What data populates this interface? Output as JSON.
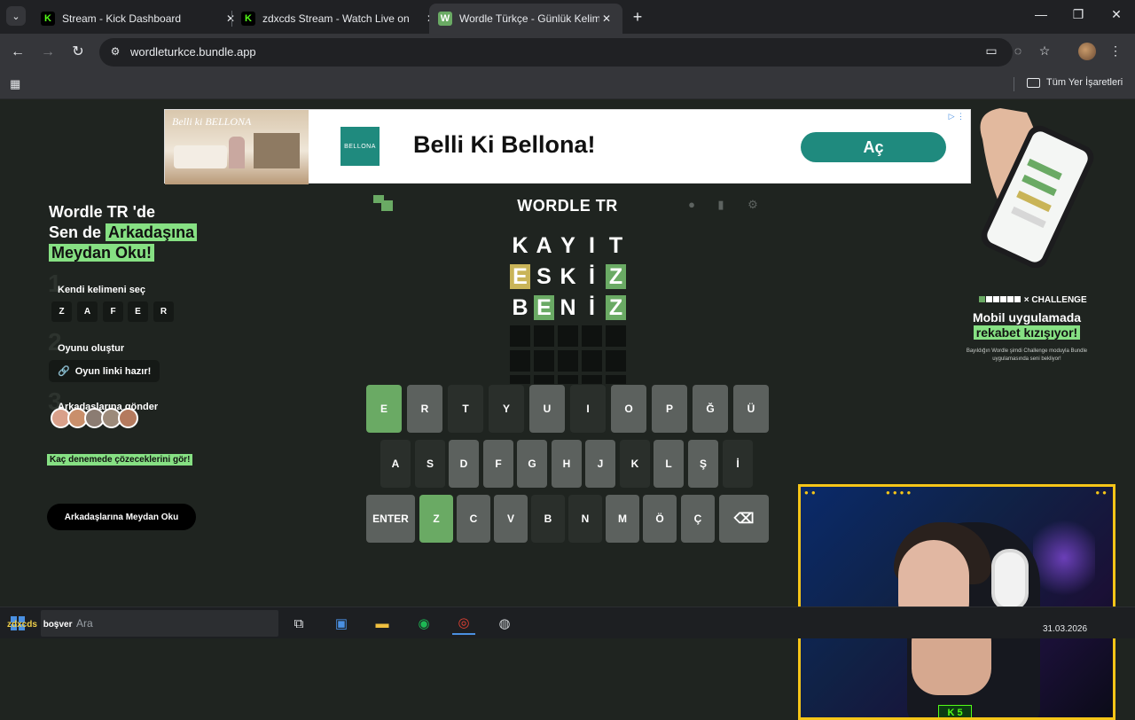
{
  "browser": {
    "tabs": [
      {
        "title": "Stream - Kick Dashboard",
        "favicon": "K",
        "active": false
      },
      {
        "title": "zdxcds Stream - Watch Live on",
        "favicon": "K",
        "active": false
      },
      {
        "title": "Wordle Türkçe - Günlük Kelime",
        "favicon": "W",
        "active": true
      }
    ],
    "url": "wordleturkce.bundle.app",
    "bookmarks_all": "Tüm Yer İşaretleri"
  },
  "ad": {
    "image_brand": "Belli ki BELLONA",
    "logo_text": "BELLONA",
    "headline": "Belli Ki Bellona!",
    "cta": "Aç"
  },
  "promo": {
    "title_line1": "Wordle TR 'de",
    "title_line2a": "Sen de ",
    "title_line2b": "Arkadaşına",
    "title_line3": "Meydan Oku!",
    "step1_num": "1",
    "step1_label": "Kendi kelimeni seç",
    "step1_letters": [
      "Z",
      "A",
      "F",
      "E",
      "R"
    ],
    "step2_num": "2",
    "step2_label": "Oyunu oluştur",
    "step2_chip": "Oyun linki hazır!",
    "step3_num": "3",
    "step3_label": "Arkadaşlarına gönder",
    "tag": "Kaç denemede çözeceklerini gör!",
    "button": "Arkadaşlarına Meydan Oku"
  },
  "game": {
    "title": "WORDLE TR",
    "rows": [
      [
        {
          "l": "K",
          "s": "plain"
        },
        {
          "l": "A",
          "s": "plain"
        },
        {
          "l": "Y",
          "s": "plain"
        },
        {
          "l": "I",
          "s": "plain"
        },
        {
          "l": "T",
          "s": "plain"
        }
      ],
      [
        {
          "l": "E",
          "s": "present"
        },
        {
          "l": "S",
          "s": "plain"
        },
        {
          "l": "K",
          "s": "plain"
        },
        {
          "l": "İ",
          "s": "plain"
        },
        {
          "l": "Z",
          "s": "correct"
        }
      ],
      [
        {
          "l": "B",
          "s": "plain"
        },
        {
          "l": "E",
          "s": "correct"
        },
        {
          "l": "N",
          "s": "plain"
        },
        {
          "l": "İ",
          "s": "plain"
        },
        {
          "l": "Z",
          "s": "correct"
        }
      ]
    ],
    "keyboard": [
      [
        {
          "k": "E",
          "s": "correct"
        },
        {
          "k": "R",
          "s": "used"
        },
        {
          "k": "T",
          "s": "plain"
        },
        {
          "k": "Y",
          "s": "plain"
        },
        {
          "k": "U",
          "s": "used"
        },
        {
          "k": "I",
          "s": "plain"
        },
        {
          "k": "O",
          "s": "used"
        },
        {
          "k": "P",
          "s": "used"
        },
        {
          "k": "Ğ",
          "s": "used"
        },
        {
          "k": "Ü",
          "s": "used"
        }
      ],
      [
        {
          "k": "A",
          "s": "plain"
        },
        {
          "k": "S",
          "s": "plain"
        },
        {
          "k": "D",
          "s": "used"
        },
        {
          "k": "F",
          "s": "used"
        },
        {
          "k": "G",
          "s": "used"
        },
        {
          "k": "H",
          "s": "used"
        },
        {
          "k": "J",
          "s": "used"
        },
        {
          "k": "K",
          "s": "plain"
        },
        {
          "k": "L",
          "s": "used"
        },
        {
          "k": "Ş",
          "s": "used"
        },
        {
          "k": "İ",
          "s": "plain"
        }
      ],
      [
        {
          "k": "ENTER",
          "s": "used"
        },
        {
          "k": "Z",
          "s": "correct"
        },
        {
          "k": "C",
          "s": "used"
        },
        {
          "k": "V",
          "s": "used"
        },
        {
          "k": "B",
          "s": "plain"
        },
        {
          "k": "N",
          "s": "plain"
        },
        {
          "k": "M",
          "s": "used"
        },
        {
          "k": "Ö",
          "s": "used"
        },
        {
          "k": "Ç",
          "s": "used"
        },
        {
          "k": "⌫",
          "s": "used"
        }
      ]
    ]
  },
  "right_promo": {
    "brand": "CHALLENGE",
    "headline1": "Mobil uygulamada",
    "headline2": "rekabet kızışıyor!",
    "sub": "Bayıldığın Wordle şimdi Challenge moduyla Bundle uygulamasında seni bekliyor!"
  },
  "stream": {
    "badge": "5"
  },
  "taskbar": {
    "search_placeholder": "Ara",
    "chat_user": "zdxcds",
    "chat_text": "boşver",
    "date": "31.03.2026"
  },
  "colors": {
    "correct": "#6aaa64",
    "present": "#c9b458",
    "highlight": "#86e083",
    "ad_teal": "#1f8a7e",
    "cam_frame": "#f5c518"
  }
}
